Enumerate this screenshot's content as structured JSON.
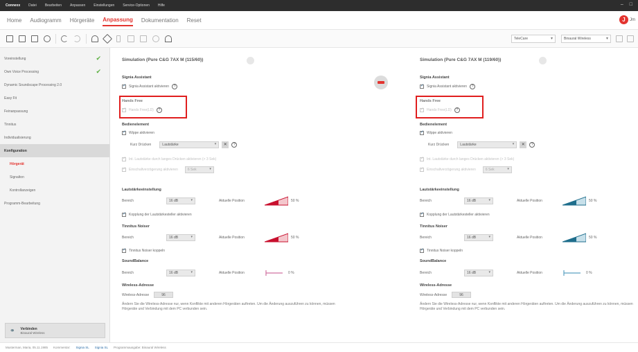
{
  "titlebar": {
    "items": [
      "Connexx",
      "Datei",
      "Bearbeiten",
      "Anpassen",
      "Einstellungen",
      "Service-Optionen",
      "Hilfe"
    ],
    "window_controls": [
      "–",
      "□"
    ]
  },
  "nav": {
    "tabs": [
      {
        "label": "Home",
        "active": false
      },
      {
        "label": "Audiogramm",
        "active": false
      },
      {
        "label": "Hörgeräte",
        "active": false
      },
      {
        "label": "Anpassung",
        "active": true
      },
      {
        "label": "Dokumentation",
        "active": false
      },
      {
        "label": "Reset",
        "active": false
      }
    ],
    "user_badge": "J",
    "user_text": "Jm"
  },
  "toolbar": {
    "select1": "TeleCare",
    "select2": "Binaural Wireless"
  },
  "sidebar": {
    "items": [
      {
        "label": "Voreinstellung",
        "checked": true
      },
      {
        "label": "Own Voice Processing",
        "checked": true
      },
      {
        "label": "Dynamic Soundscape Processing 2.0",
        "checked": false
      },
      {
        "label": "Easy Fit",
        "checked": false
      },
      {
        "label": "Feinanpassung",
        "checked": false
      },
      {
        "label": "Tinnitus",
        "checked": false
      },
      {
        "label": "Individualisierung",
        "checked": false
      }
    ],
    "group": "Konfiguration",
    "sub_items": [
      {
        "label": "Hörgerät",
        "active": true
      },
      {
        "label": "Signalton",
        "active": false
      },
      {
        "label": "Kontrollanzeigen",
        "active": false
      }
    ],
    "extra_item": "Programm-Bearbeitung",
    "footer": {
      "title": "Verbinden",
      "subtitle": "Binaural Wireless"
    }
  },
  "panels": {
    "left": {
      "title": "Simulation (Pure C&G 7AX M (115/60))",
      "signia_assistant_heading": "Signia Assistant",
      "signia_assistant_label": "Signia Assistant aktivieren",
      "hands_free_heading": "Hands Free",
      "hands_free_label": "Hands Free(LD)",
      "bedienelement_heading": "Bedienelement",
      "wippe_label": "Wippe aktivieren",
      "kurz_druecken_label": "Kurz Drücken",
      "kurz_druecken_value": "Lautstärke",
      "opt1_label": "Int. Lautstärke durch langes Drücken aktivieren (> 3 Sek)",
      "opt2_label": "Einschaltverzögerung aktivieren",
      "opt2_value": "6 Sek",
      "lautstaerke_heading": "Lautstärkeeinstellung",
      "bereich_label": "Bereich",
      "bereich_value": "16 dB",
      "aktuelle_position_label": "Aktuelle Position",
      "lautstaerke_percent": "50 %",
      "kopplung_label": "Kopplung der Lautstärkesteller aktivieren",
      "tinnitus_heading": "Tinnitus Noiser",
      "tinnitus_bereich_value": "16 dB",
      "tinnitus_percent": "50 %",
      "tinnitus_kopplung_label": "Tinnitus Noiser koppeln",
      "soundbalance_heading": "SoundBalance",
      "soundbalance_value": "16 dB",
      "soundbalance_percent": "0 %",
      "wireless_heading": "Wireless-Adresse",
      "wireless_label": "Wireless-Adresse",
      "wireless_value": "96",
      "note": "Ändern Sie die Wireless-Adresse nur, wenn Konflikte mit anderen Hörgeräten auftreten. Um die Änderung auszuführen zu können, müssen Hörgeräte und Verbindung mit dem PC verbunden sein."
    },
    "right": {
      "title": "Simulation (Pure C&G 7AX M (119/60))",
      "signia_assistant_heading": "Signia Assistant",
      "signia_assistant_label": "Signia Assistant aktivieren",
      "hands_free_heading": "Hands Free",
      "hands_free_label": "Hands Free(LD)",
      "bedienelement_heading": "Bedienelement",
      "wippe_label": "Wippe aktivieren",
      "kurz_druecken_label": "Kurz Drücken",
      "kurz_druecken_value": "Lautstärke",
      "opt1_label": "Int. Lautstärke durch langes Drücken aktivieren (> 3 Sek)",
      "opt2_label": "Einschaltverzögerung aktivieren",
      "opt2_value": "6 Sek",
      "lautstaerke_heading": "Lautstärkeeinstellung",
      "bereich_label": "Bereich",
      "bereich_value": "16 dB",
      "aktuelle_position_label": "Aktuelle Position",
      "lautstaerke_percent": "50 %",
      "kopplung_label": "Kopplung der Lautstärkesteller aktivieren",
      "tinnitus_heading": "Tinnitus Noiser",
      "tinnitus_bereich_value": "16 dB",
      "tinnitus_percent": "50 %",
      "tinnitus_kopplung_label": "Tinnitus Noiser koppeln",
      "soundbalance_heading": "SoundBalance",
      "soundbalance_value": "16 dB",
      "soundbalance_percent": "0 %",
      "wireless_heading": "Wireless-Adresse",
      "wireless_label": "Wireless-Adresse",
      "wireless_value": "96",
      "note": "Ändern Sie die Wireless-Adresse nur, wenn Konflikte mit anderen Hörgeräten auftreten. Um die Änderung auszuführen zu können, müssen Hörgeräte und Verbindung mit dem PC verbunden sein."
    }
  },
  "statusbar": {
    "text1": "Musterman, Maria, 05.11.1985",
    "text2": "Kommentar:",
    "link1": "Signia SL",
    "link2": "Signia SL",
    "text3": "Programmausgabe: Binaural Wireless"
  },
  "colors": {
    "accent": "#e3342f",
    "left_ramp": "#c8102e",
    "right_ramp": "#1f6e8c",
    "balance": "#d070a0",
    "highlight_box": "#e01e1e"
  }
}
